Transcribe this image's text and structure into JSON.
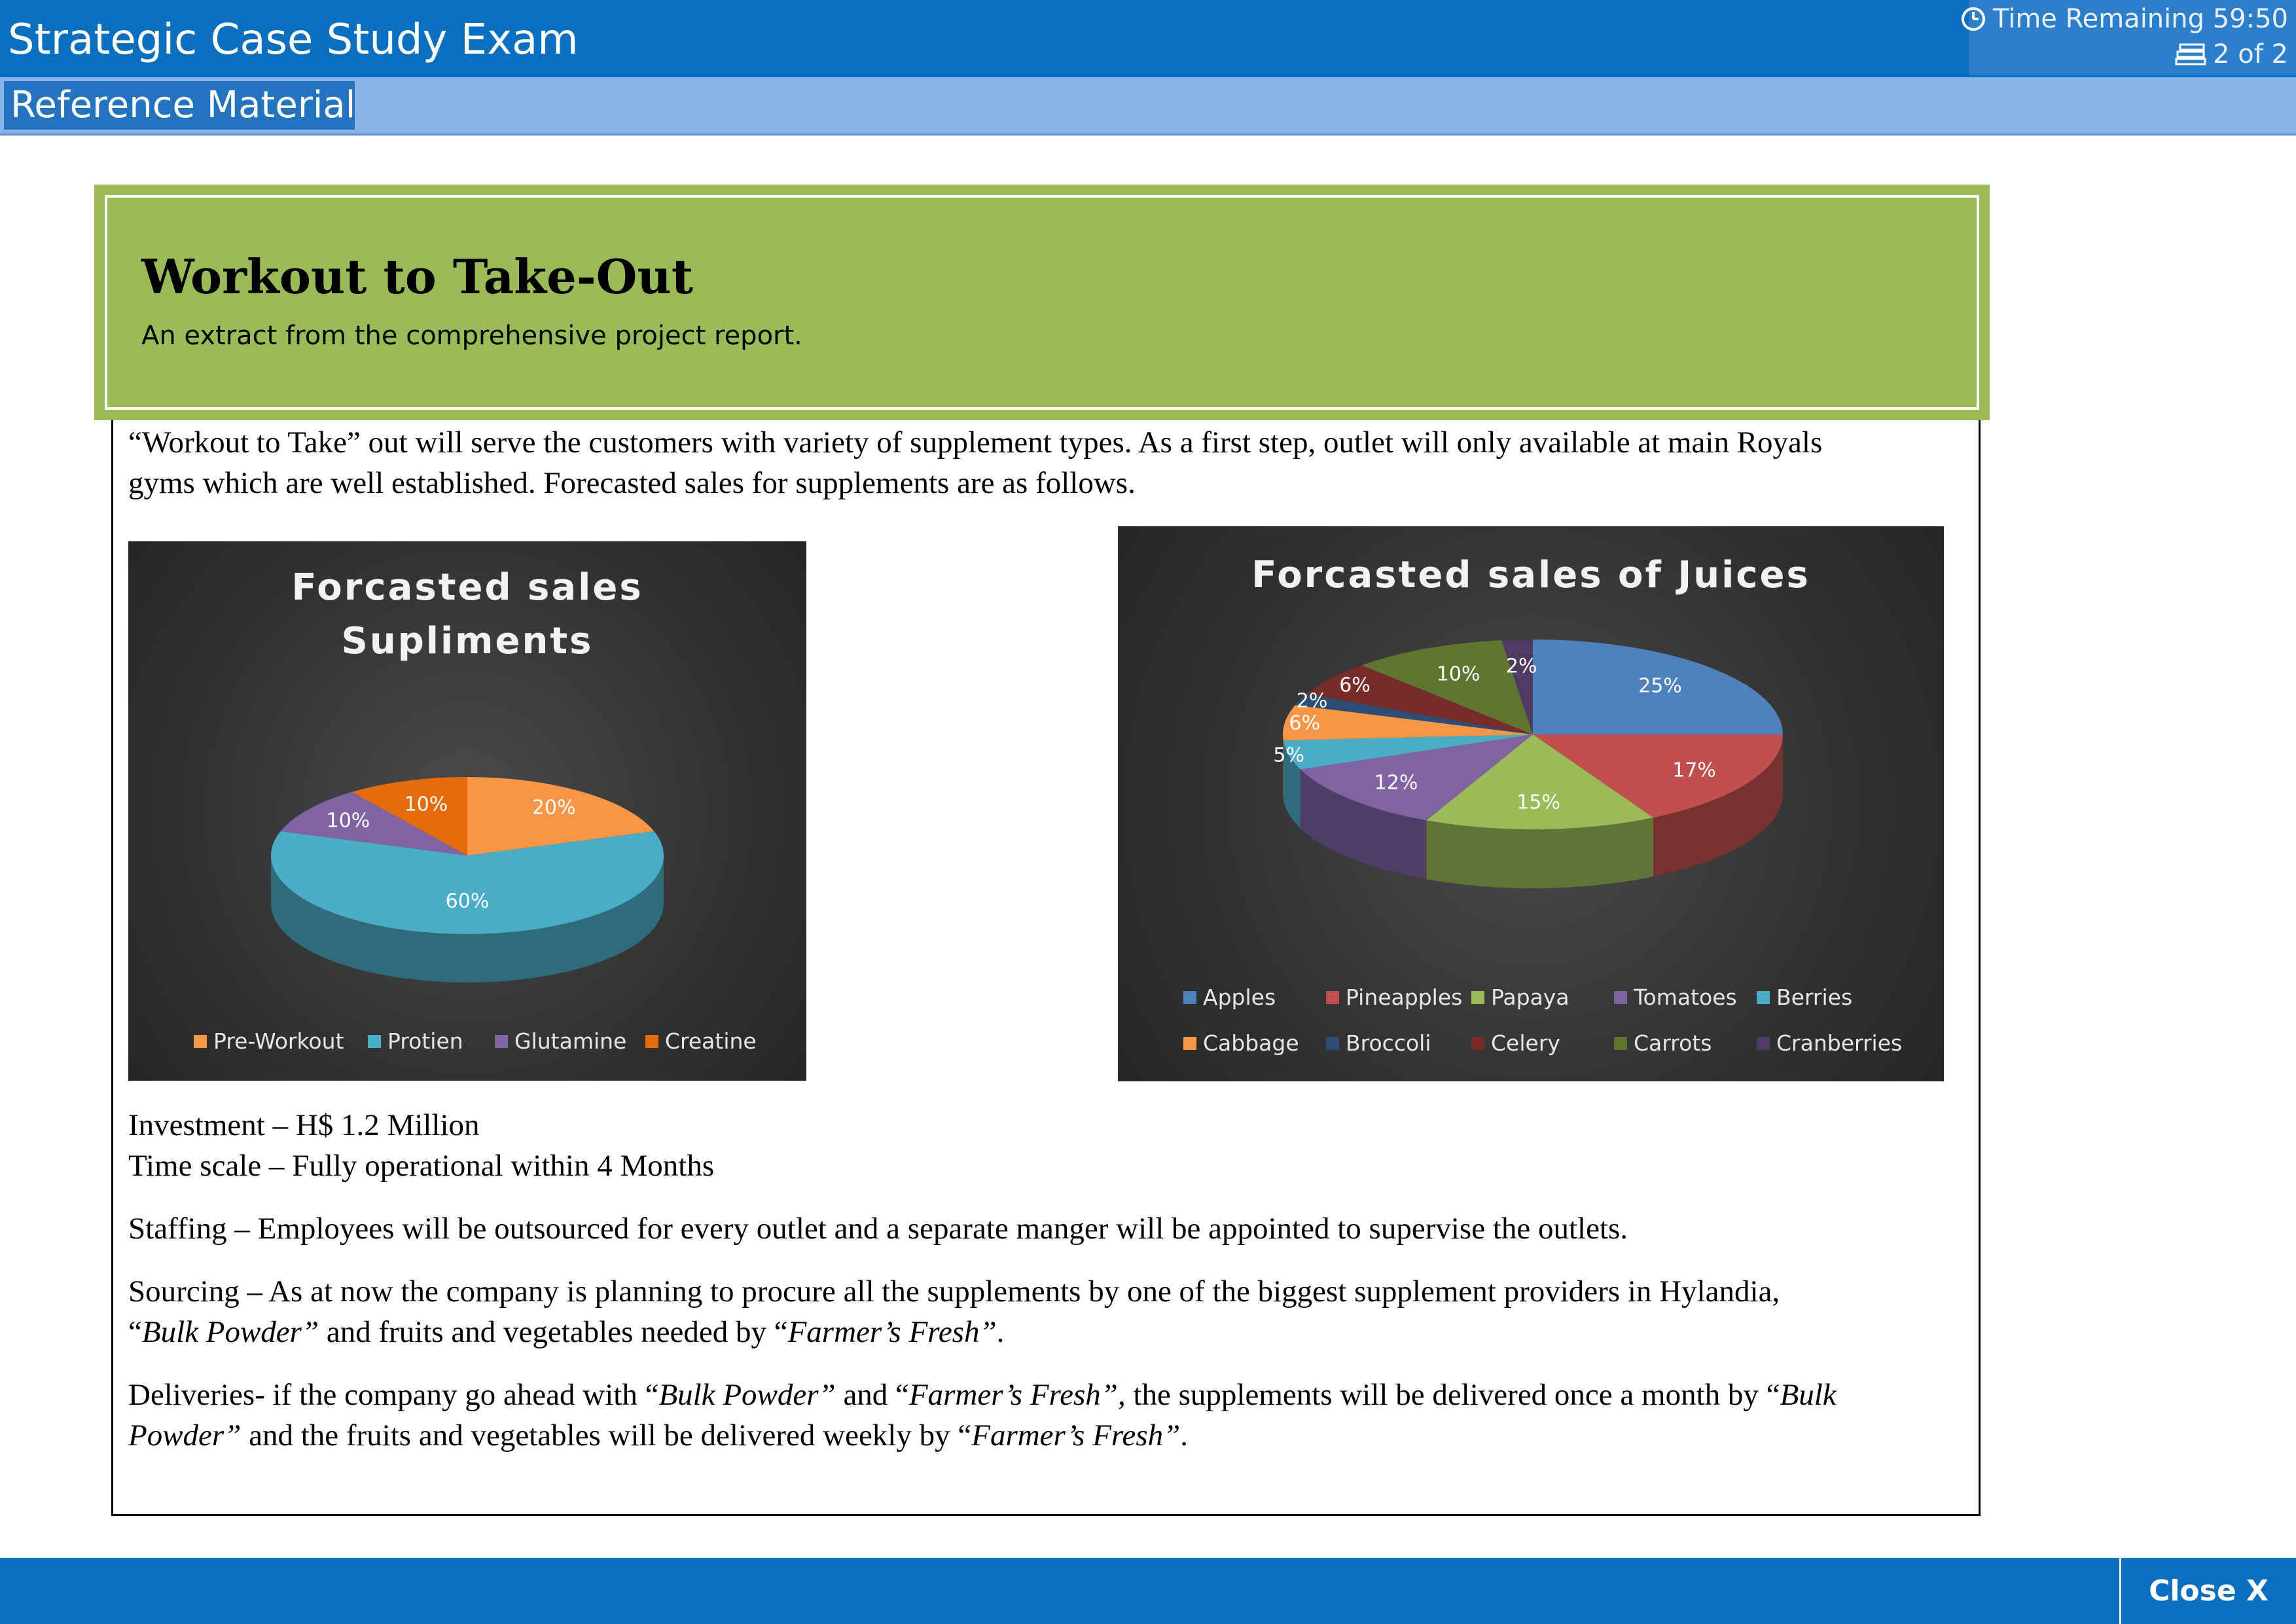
{
  "app": {
    "title": "Strategic Case Study Exam",
    "timer": "Time Remaining 59:50",
    "page": "2 of 2"
  },
  "tabs": {
    "reference": "Reference Material"
  },
  "banner": {
    "title": "Workout to Take-Out",
    "subtitle": "An extract from the comprehensive project report."
  },
  "content": {
    "intro_line1": "“Workout to Take” out will serve the customers with variety of supplement types. As a first step, outlet will only available at main Royals",
    "intro_line2": "gyms which are well established. Forecasted sales for supplements are as follows.",
    "investment": "Investment – H$ 1.2 Million",
    "timescale": "Time scale –  Fully operational within 4 Months",
    "staffing": "Staffing – Employees will be outsourced for every outlet and a separate manger will be appointed to supervise the outlets.",
    "sourcing_line1": "Sourcing – As at now the company is planning to procure all the supplements by one of the biggest supplement providers in  Hylandia,",
    "sourcing_line2_a": "“",
    "sourcing_line2_b": "Bulk Powder”",
    "sourcing_line2_c": " and fruits and vegetables needed by “",
    "sourcing_line2_d": "Farmer’s Fresh”",
    "sourcing_line2_e": ".",
    "deliveries_line1_a": "Deliveries- if the company go ahead with “",
    "deliveries_line1_b": "Bulk Powder”",
    "deliveries_line1_c": " and “",
    "deliveries_line1_d": "Farmer’s Fresh”,",
    "deliveries_line1_e": " the supplements will be delivered once a month by “",
    "deliveries_line1_f": "Bulk",
    "deliveries_line2_a": "Powder”",
    "deliveries_line2_b": " and the fruits and vegetables will be delivered weekly by “",
    "deliveries_line2_c": "Farmer’s Fresh”",
    "deliveries_line2_d": "."
  },
  "footer": {
    "close": "Close X"
  },
  "chart_data": [
    {
      "type": "pie",
      "title_line1": "Forcasted sales",
      "title_line2": "Supliments",
      "categories": [
        "Pre-Workout",
        "Protien",
        "Glutamine",
        "Creatine"
      ],
      "values": [
        20,
        60,
        10,
        10
      ],
      "labels": [
        "20%",
        "60%",
        "10%",
        "10%"
      ],
      "colors": [
        "#f79646",
        "#4bacc6",
        "#8064a2",
        "#e46c0a"
      ],
      "legend_position": "bottom"
    },
    {
      "type": "pie",
      "title": "Forcasted sales of Juices",
      "categories": [
        "Apples",
        "Pineapples",
        "Papaya",
        "Tomatoes",
        "Berries",
        "Cabbage",
        "Broccoli",
        "Celery",
        "Carrots",
        "Cranberries"
      ],
      "values": [
        25,
        17,
        15,
        12,
        5,
        6,
        2,
        6,
        10,
        2
      ],
      "labels": [
        "25%",
        "17%",
        "15%",
        "12%",
        "5%",
        "6%",
        "2%",
        "6%",
        "10%",
        "2%"
      ],
      "colors": [
        "#4f81bd",
        "#c0504d",
        "#9bbb59",
        "#8064a2",
        "#4bacc6",
        "#f79646",
        "#2c4d75",
        "#772c2a",
        "#5f7530",
        "#4d3b62"
      ],
      "legend_position": "bottom"
    }
  ]
}
